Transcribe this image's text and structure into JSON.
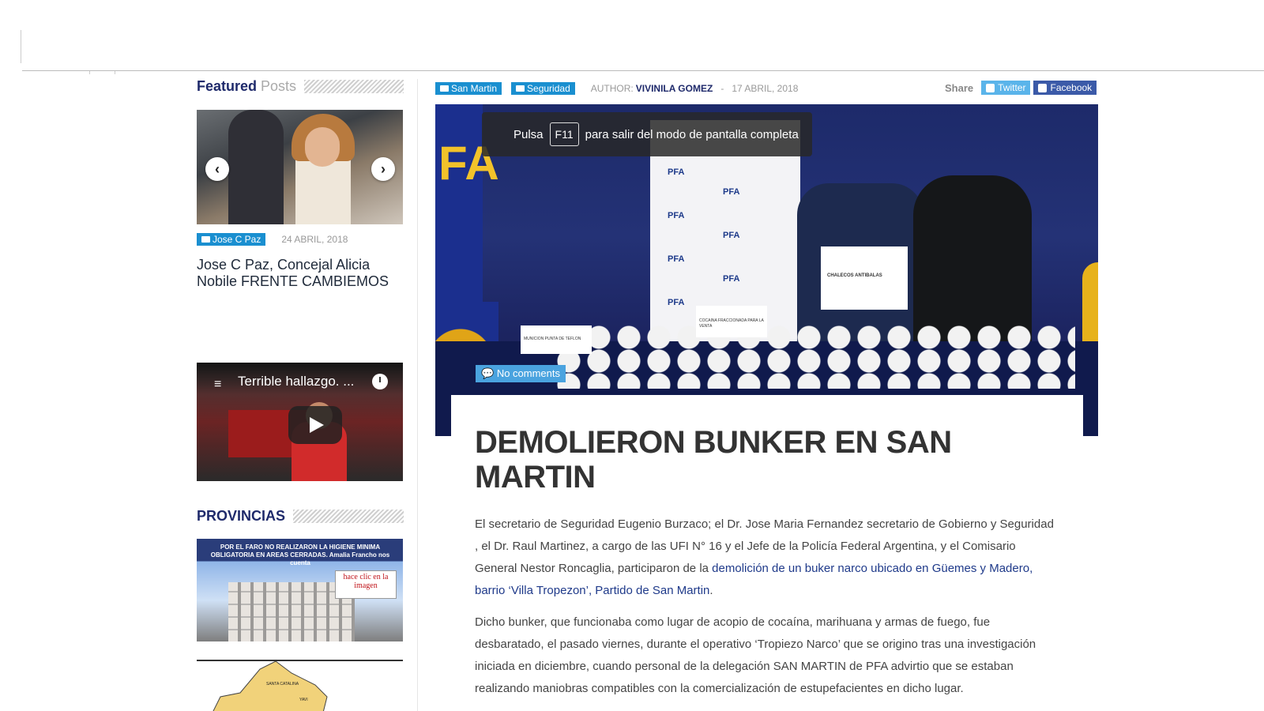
{
  "sidebar": {
    "featured_title_bold": "Featured",
    "featured_title_light": "Posts",
    "featured_post": {
      "category": "Jose C Paz",
      "date": "24 ABRIL, 2018",
      "title": "Jose C Paz, Concejal Alicia Nobile FRENTE CAMBIEMOS"
    },
    "video": {
      "title": "Terrible hallazgo. ..."
    },
    "provincias_title": "PROVINCIAS",
    "provincias_banner": "POR EL FARO NO REALIZARON LA HIGIENE MINIMA OBLIGATORIA EN AREAS CERRADAS. Amalia Francho nos cuenta",
    "provincias_click": "hace clic en la imagen",
    "map_labels": [
      "SANTA CATALINA",
      "YAVI"
    ]
  },
  "article": {
    "categories": [
      "San Martin",
      "Seguridad"
    ],
    "author_label": "AUTHOR:",
    "author_name": "VIVINILA GOMEZ",
    "separator": "-",
    "date": "17 ABRIL, 2018",
    "share_label": "Share",
    "share_twitter": "Twitter",
    "share_facebook": "Facebook",
    "fullscreen_pre": "Pulsa",
    "fullscreen_key": "F11",
    "fullscreen_post": "para salir del modo de pantalla completa",
    "comments": "No comments",
    "title": "DEMOLIERON BUNKER EN SAN MARTIN",
    "p1_start": "El secretario de Seguridad Eugenio Burzaco;  el  Dr. Jose Maria Fernandez  secretario de Gobierno y Seguridad , el Dr. Raul Martinez, a cargo de las UFI N° 16 y el Jefe de la Policía Federal Argentina,  y el Comisario General Nestor Roncaglia, participaron de la ",
    "p1_link": "demolición de un buker narco ubicado en Güemes y Madero, barrio ‘Villa Tropezon’, Partido de San Martin",
    "p1_end": ".",
    "p2": "Dicho bunker, que funcionaba como lugar de acopio de cocaína, marihuana y armas de fuego, fue desbaratado, el pasado viernes, durante el operativo ‘Tropiezo Narco’ que se origino tras una investigación iniciada en diciembre, cuando personal de la delegación SAN MARTIN de PFA advirtio que se estaban realizando maniobras compatibles con la comercialización de estupefacientes en dicho lugar."
  },
  "hero_texts": {
    "pfa_left": "FA",
    "backdrop_logo": "PFA",
    "vest_sign": "CHALECOS ANTIBALAS",
    "label_a": "MUNICION PUNTA DE TEFLON",
    "label_b": "COCAINA FRACCIONADA PARA LA VENTA"
  },
  "colors": {
    "accent_blue": "#1a8fd0",
    "title_navy": "#1f2a6b",
    "twitter": "#5ab4ea",
    "facebook": "#3b5aa8"
  }
}
